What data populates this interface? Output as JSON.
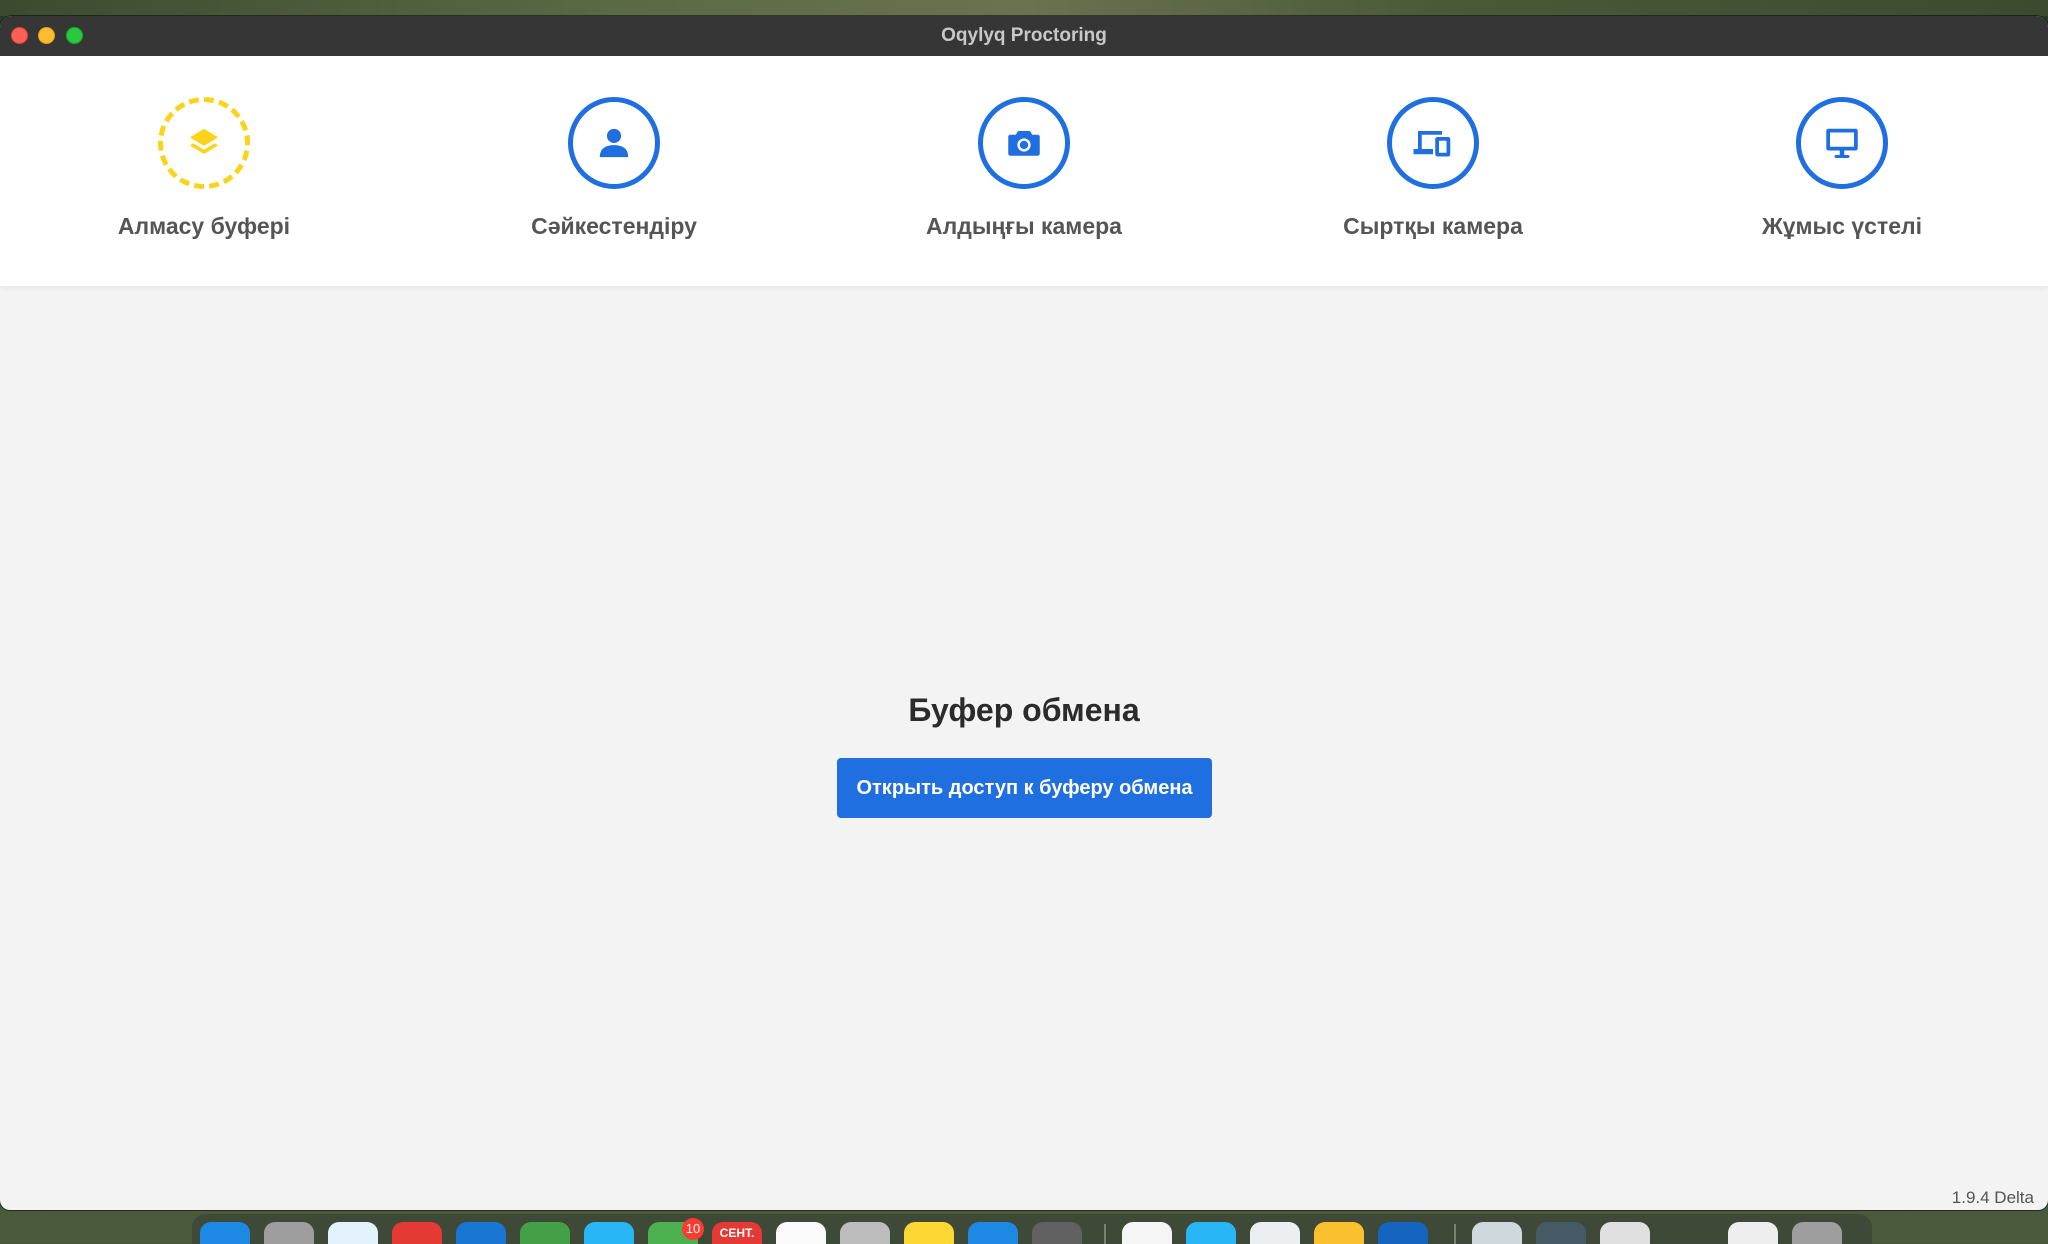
{
  "window": {
    "title": "Oqylyq Proctoring"
  },
  "steps": [
    {
      "label": "Алмасу буфері",
      "icon": "layers-icon",
      "state": "active"
    },
    {
      "label": "Сәйкестендіру",
      "icon": "user-icon",
      "state": "pending"
    },
    {
      "label": "Алдыңғы камера",
      "icon": "camera-icon",
      "state": "pending"
    },
    {
      "label": "Сыртқы камера",
      "icon": "devices-icon",
      "state": "pending"
    },
    {
      "label": "Жұмыс үстелі",
      "icon": "monitor-icon",
      "state": "pending"
    }
  ],
  "main": {
    "title": "Буфер обмена",
    "button_label": "Открыть доступ к буферу обмена"
  },
  "footer": {
    "version": "1.9.4 Delta"
  },
  "dock": {
    "messages_badge": "10",
    "calendar_label": "СЕНТ."
  },
  "colors": {
    "accent": "#1f6fe0",
    "active_step": "#fad41a",
    "background": "#f3f3f3",
    "titlebar": "#363636"
  }
}
